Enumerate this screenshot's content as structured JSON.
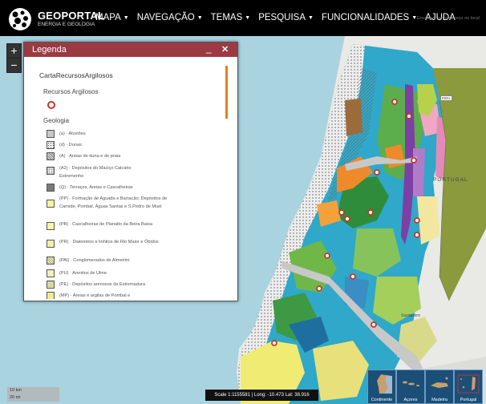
{
  "header": {
    "brand": "GEOPORTAL",
    "brand_sub": "ENERGIA E GEOLOGIA",
    "logo_icon": "geoportal-logo-icon",
    "nav": [
      {
        "label": "MAPA",
        "has_caret": true
      },
      {
        "label": "NAVEGAÇÃO",
        "has_caret": true
      },
      {
        "label": "TEMAS",
        "has_caret": true
      },
      {
        "label": "PESQUISA",
        "has_caret": true
      },
      {
        "label": "FUNCIONALIDADES",
        "has_caret": true
      },
      {
        "label": "AJUDA",
        "has_caret": false
      }
    ],
    "search_placeholder": "Encontrar um endereço ou local"
  },
  "map": {
    "zoom_in": "+",
    "zoom_out": "−",
    "labels": {
      "portugal": "PORTUGAL",
      "santarem": "Santarém",
      "lisbon_road": "E801"
    }
  },
  "legend": {
    "title": "Legenda",
    "minimize_icon": "minimize-icon",
    "close_label": "✕",
    "layer_name": "CartaRecursosArgilosos",
    "recursos_title": "Recursos Argilosos",
    "recursos_color": "#c0392b",
    "geologia_title": "Geologia",
    "items": [
      {
        "label": "(a) · Aluviões",
        "color": "#c8c8c8",
        "pattern": "plain"
      },
      {
        "label": "(d) · Dunas",
        "color": "#ffffff",
        "pattern": "dots"
      },
      {
        "label": "(A) · Areias de duna e de praia",
        "color": "#d9d9d9",
        "pattern": "hatch"
      },
      {
        "label": "(A2) · Depósitos do Maciço Calcário Estremenho",
        "color": "#ffffff",
        "pattern": "grid"
      },
      {
        "label": "(Q) · Terraços, Areias e Cascalheiras",
        "color": "#7a7a7a",
        "pattern": "plain"
      },
      {
        "label": "(PP) · Formação de Aguada e Barracão; Depósitos de Carnide, Pombal, Águas Santas e S.Pedro de Muel",
        "color": "#f7f3a0",
        "pattern": "plain"
      },
      {
        "label": "(PB) · Cascalheiras de Planalto da Beira Baixa",
        "color": "#fdf6a8",
        "pattern": "plain"
      },
      {
        "label": "(PR) · Diatomitos e linhitos de Rio Maior e Óbidos",
        "color": "#f5f0b0",
        "pattern": "plain"
      },
      {
        "label": "(PAI) · Conglomerados de Almeirim",
        "color": "#f2ee9e",
        "pattern": "hatch"
      },
      {
        "label": "(PU) · Arenitos de Ulme",
        "color": "#f4f0b8",
        "pattern": "plain"
      },
      {
        "label": "(PE) · Depósitos arenosos da Estremadura",
        "color": "#e8e8a0",
        "pattern": "hatch"
      },
      {
        "label": "(MP) · Areias e argilas de Pombal e",
        "color": "#f0ea90",
        "pattern": "plain"
      }
    ]
  },
  "scale": {
    "km": "10 km",
    "mi": "20 mi"
  },
  "status": "Scale 1:1155581 | Long: -10.473 Lat: 38.916",
  "basemaps": [
    {
      "label": "Continente",
      "icon": "portugal-mainland-map-icon"
    },
    {
      "label": "Açores",
      "icon": "azores-map-icon"
    },
    {
      "label": "Madeira",
      "icon": "madeira-map-icon"
    },
    {
      "label": "Portugal",
      "icon": "portugal-overview-map-icon"
    }
  ]
}
